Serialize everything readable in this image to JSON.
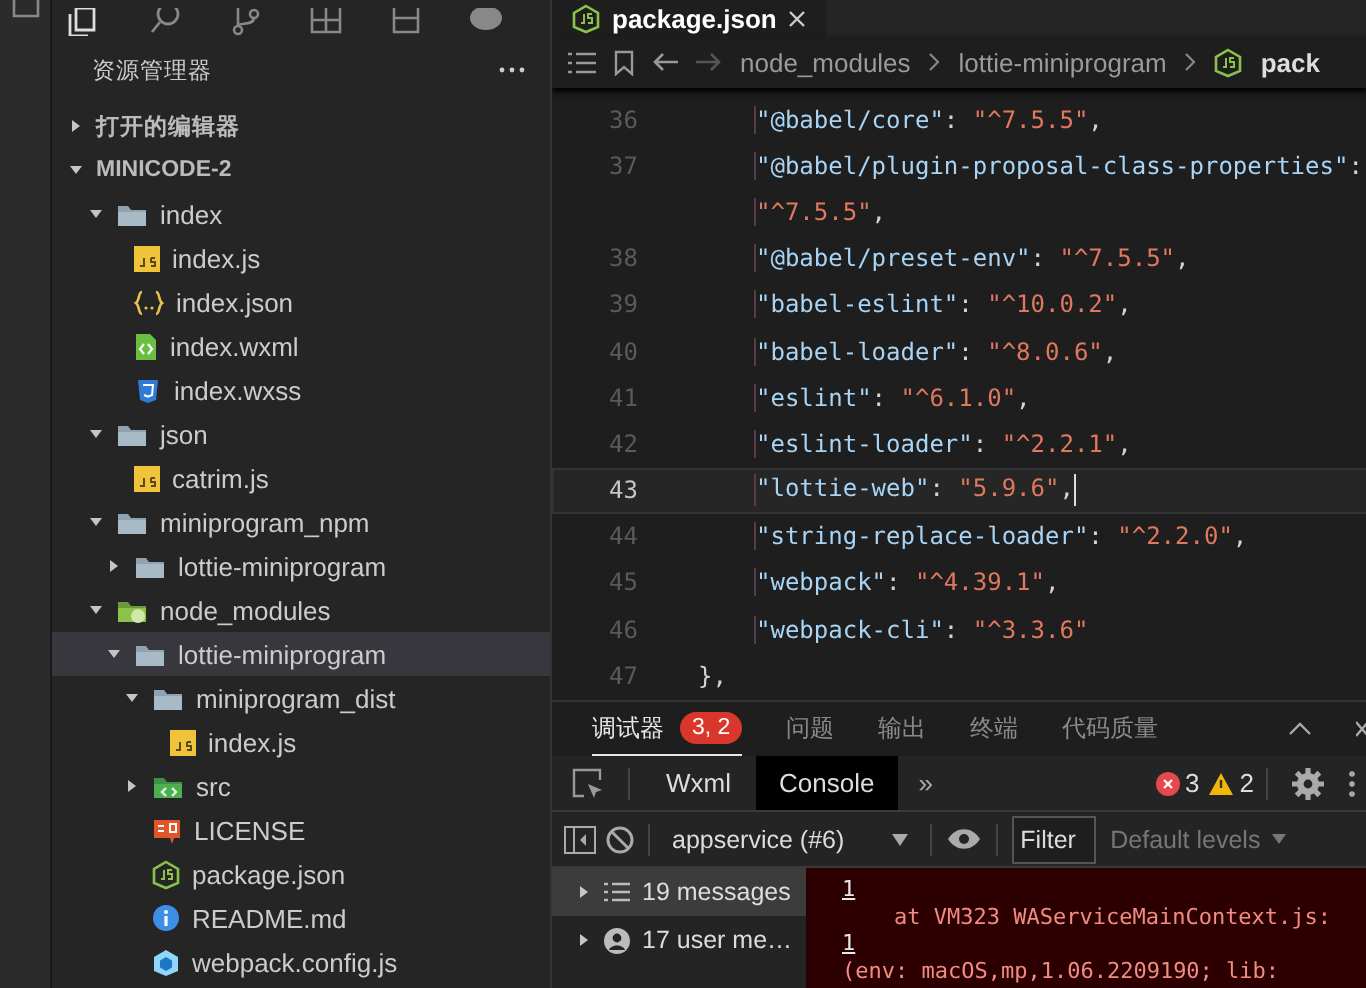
{
  "explorer": {
    "title": "资源管理器",
    "sections": [
      {
        "label": "打开的编辑器",
        "expanded": false
      },
      {
        "label": "MINICODE-2",
        "expanded": true
      }
    ],
    "tree": [
      {
        "label": "index",
        "kind": "folder",
        "expanded": true,
        "selected": false,
        "children": [
          {
            "label": "index.js",
            "kind": "js",
            "selected": false
          },
          {
            "label": "index.json",
            "kind": "json",
            "selected": false
          },
          {
            "label": "index.wxml",
            "kind": "wxml",
            "selected": false
          },
          {
            "label": "index.wxss",
            "kind": "wxss",
            "selected": false
          }
        ]
      },
      {
        "label": "json",
        "kind": "folder",
        "expanded": true,
        "selected": false,
        "children": [
          {
            "label": "catrim.js",
            "kind": "js",
            "selected": false
          }
        ]
      },
      {
        "label": "miniprogram_npm",
        "kind": "folder",
        "expanded": true,
        "selected": false,
        "children": [
          {
            "label": "lottie-miniprogram",
            "kind": "folder",
            "expanded": false,
            "selected": false
          }
        ]
      },
      {
        "label": "node_modules",
        "kind": "folder-node",
        "expanded": true,
        "selected": false,
        "children": [
          {
            "label": "lottie-miniprogram",
            "kind": "folder",
            "expanded": true,
            "selected": true,
            "children": [
              {
                "label": "miniprogram_dist",
                "kind": "folder",
                "expanded": true,
                "selected": false,
                "children": [
                  {
                    "label": "index.js",
                    "kind": "js",
                    "selected": false
                  }
                ]
              },
              {
                "label": "src",
                "kind": "folder-src",
                "expanded": false,
                "selected": false
              },
              {
                "label": "LICENSE",
                "kind": "license",
                "selected": false
              },
              {
                "label": "package.json",
                "kind": "node",
                "selected": false
              },
              {
                "label": "README.md",
                "kind": "info",
                "selected": false
              },
              {
                "label": "webpack.config.js",
                "kind": "webpack",
                "selected": false
              }
            ]
          }
        ]
      }
    ]
  },
  "editor": {
    "tab": {
      "label": "package.json",
      "selected": true
    },
    "breadcrumbs": [
      "node_modules",
      "lottie-miniprogram",
      "pack"
    ],
    "lines": [
      {
        "number": "36",
        "current": false,
        "tokens": [
          {
            "kind": "key",
            "text": "\"@babel/core\""
          },
          {
            "kind": "punct",
            "text": ": "
          },
          {
            "kind": "string",
            "text": "\"^7.5.5\""
          },
          {
            "kind": "punct",
            "text": ","
          }
        ]
      },
      {
        "number": "37",
        "current": false,
        "tokens": [
          {
            "kind": "key",
            "text": "\"@babel/plugin-proposal-class-properties\""
          },
          {
            "kind": "punct",
            "text": ":"
          }
        ]
      },
      {
        "current": false,
        "tokens": [
          {
            "kind": "string",
            "text": "\"^7.5.5\""
          },
          {
            "kind": "punct",
            "text": ","
          }
        ]
      },
      {
        "number": "38",
        "current": false,
        "tokens": [
          {
            "kind": "key",
            "text": "\"@babel/preset-env\""
          },
          {
            "kind": "punct",
            "text": ": "
          },
          {
            "kind": "string",
            "text": "\"^7.5.5\""
          },
          {
            "kind": "punct",
            "text": ","
          }
        ]
      },
      {
        "number": "39",
        "current": false,
        "tokens": [
          {
            "kind": "key",
            "text": "\"babel-eslint\""
          },
          {
            "kind": "punct",
            "text": ": "
          },
          {
            "kind": "string",
            "text": "\"^10.0.2\""
          },
          {
            "kind": "punct",
            "text": ","
          }
        ]
      },
      {
        "number": "40",
        "current": false,
        "tokens": [
          {
            "kind": "key",
            "text": "\"babel-loader\""
          },
          {
            "kind": "punct",
            "text": ": "
          },
          {
            "kind": "string",
            "text": "\"^8.0.6\""
          },
          {
            "kind": "punct",
            "text": ","
          }
        ]
      },
      {
        "number": "41",
        "current": false,
        "tokens": [
          {
            "kind": "key",
            "text": "\"eslint\""
          },
          {
            "kind": "punct",
            "text": ": "
          },
          {
            "kind": "string",
            "text": "\"^6.1.0\""
          },
          {
            "kind": "punct",
            "text": ","
          }
        ]
      },
      {
        "number": "42",
        "current": false,
        "tokens": [
          {
            "kind": "key",
            "text": "\"eslint-loader\""
          },
          {
            "kind": "punct",
            "text": ": "
          },
          {
            "kind": "string",
            "text": "\"^2.2.1\""
          },
          {
            "kind": "punct",
            "text": ","
          }
        ]
      },
      {
        "number": "43",
        "current": true,
        "tokens": [
          {
            "kind": "key",
            "text": "\"lottie-web\""
          },
          {
            "kind": "punct",
            "text": ": "
          },
          {
            "kind": "string",
            "text": "\"5.9.6\""
          },
          {
            "kind": "punct",
            "text": ","
          }
        ]
      },
      {
        "number": "44",
        "current": false,
        "tokens": [
          {
            "kind": "key",
            "text": "\"string-replace-loader\""
          },
          {
            "kind": "punct",
            "text": ": "
          },
          {
            "kind": "string",
            "text": "\"^2.2.0\""
          },
          {
            "kind": "punct",
            "text": ","
          }
        ]
      },
      {
        "number": "45",
        "current": false,
        "tokens": [
          {
            "kind": "key",
            "text": "\"webpack\""
          },
          {
            "kind": "punct",
            "text": ": "
          },
          {
            "kind": "string",
            "text": "\"^4.39.1\""
          },
          {
            "kind": "punct",
            "text": ","
          }
        ]
      },
      {
        "number": "46",
        "current": false,
        "tokens": [
          {
            "kind": "key",
            "text": "\"webpack-cli\""
          },
          {
            "kind": "punct",
            "text": ": "
          },
          {
            "kind": "string",
            "text": "\"^3.3.6\""
          }
        ]
      },
      {
        "number": "47",
        "current": false,
        "outdent": true,
        "tokens": [
          {
            "kind": "punct",
            "text": "},"
          }
        ]
      }
    ]
  },
  "panel": {
    "tabs": [
      {
        "label": "调试器",
        "selected": true,
        "badge": "3, 2"
      },
      {
        "label": "问题",
        "selected": false
      },
      {
        "label": "输出",
        "selected": false
      },
      {
        "label": "终端",
        "selected": false
      },
      {
        "label": "代码质量",
        "selected": false
      }
    ],
    "devtools": {
      "tabs": [
        {
          "label": "Wxml",
          "selected": false
        },
        {
          "label": "Console",
          "selected": true
        }
      ],
      "more": "»",
      "errors": "3",
      "warnings": "2"
    },
    "filter": {
      "context": "appservice (#6)",
      "placeholder": "Filter",
      "levels": "Default levels"
    },
    "console_sidebar": [
      {
        "label": "19 messages",
        "kind": "messages",
        "selected": true
      },
      {
        "label": "17 user me…",
        "kind": "user",
        "selected": false
      }
    ],
    "console_output": [
      {
        "kind": "link",
        "text": "1"
      },
      {
        "kind": "stack",
        "text": "at VM323 WAServiceMainContext.js:"
      },
      {
        "kind": "link",
        "text": "1"
      },
      {
        "kind": "message",
        "text": "(env: macOS,mp,1.06.2209190; lib:"
      }
    ]
  }
}
